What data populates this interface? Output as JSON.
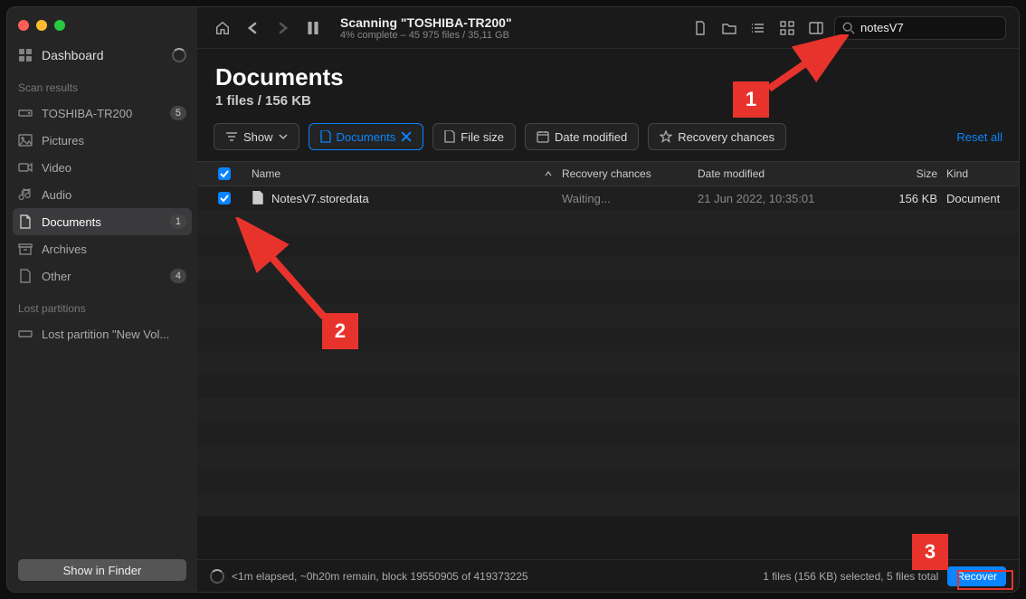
{
  "sidebar": {
    "dashboard": "Dashboard",
    "scan_header": "Scan results",
    "items": [
      {
        "label": "TOSHIBA-TR200",
        "badge": "5",
        "icon": "hdd"
      },
      {
        "label": "Pictures",
        "icon": "image"
      },
      {
        "label": "Video",
        "icon": "video"
      },
      {
        "label": "Audio",
        "icon": "audio"
      },
      {
        "label": "Documents",
        "badge": "1",
        "icon": "doc",
        "selected": true
      },
      {
        "label": "Archives",
        "icon": "archive"
      },
      {
        "label": "Other",
        "badge": "4",
        "icon": "other"
      }
    ],
    "lost_header": "Lost partitions",
    "lost_item": "Lost partition \"New Vol...",
    "show_finder": "Show in Finder"
  },
  "topbar": {
    "scan_title": "Scanning \"TOSHIBA-TR200\"",
    "scan_sub": "4% complete – 45 975 files / 35,11 GB",
    "search_value": "notesV7"
  },
  "content": {
    "title": "Documents",
    "sub": "1 files / 156 KB",
    "show_label": "Show",
    "filter_documents": "Documents",
    "filter_filesize": "File size",
    "filter_date": "Date modified",
    "filter_recchance": "Recovery chances",
    "reset": "Reset all",
    "headers": {
      "name": "Name",
      "rec": "Recovery chances",
      "date": "Date modified",
      "size": "Size",
      "kind": "Kind"
    },
    "rows": [
      {
        "name": "NotesV7.storedata",
        "rec": "Waiting...",
        "date": "21 Jun 2022, 10:35:01",
        "size": "156 KB",
        "kind": "Document"
      }
    ]
  },
  "footer": {
    "status": "<1m elapsed, ~0h20m remain, block 19550905 of 419373225",
    "summary": "1 files (156 KB) selected, 5 files total",
    "recover": "Recover"
  },
  "annotations": {
    "a1": "1",
    "a2": "2",
    "a3": "3"
  }
}
